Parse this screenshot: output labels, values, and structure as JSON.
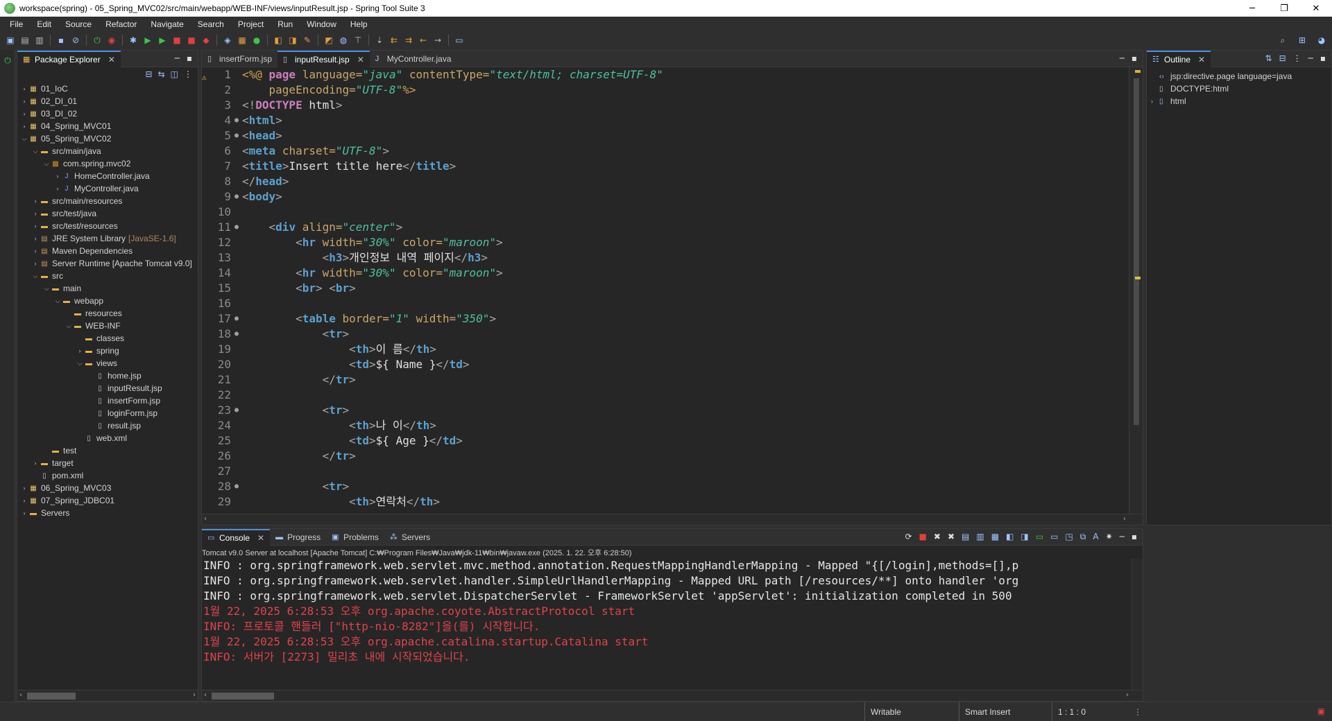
{
  "window": {
    "title": "workspace(spring) - 05_Spring_MVC02/src/main/webapp/WEB-INF/views/inputResult.jsp - Spring Tool Suite 3"
  },
  "menu": [
    "File",
    "Edit",
    "Source",
    "Refactor",
    "Navigate",
    "Search",
    "Project",
    "Run",
    "Window",
    "Help"
  ],
  "package_explorer": {
    "tab_label": "Package Explorer",
    "tree": [
      {
        "label": "01_IoC",
        "icon": "project",
        "arrow": "›",
        "indent": 0
      },
      {
        "label": "02_DI_01",
        "icon": "project",
        "arrow": "›",
        "indent": 0
      },
      {
        "label": "03_DI_02",
        "icon": "project",
        "arrow": "›",
        "indent": 0
      },
      {
        "label": "04_Spring_MVC01",
        "icon": "project",
        "arrow": "›",
        "indent": 0
      },
      {
        "label": "05_Spring_MVC02",
        "icon": "project",
        "arrow": "⌄",
        "indent": 0
      },
      {
        "label": "src/main/java",
        "icon": "folder",
        "arrow": "⌄",
        "indent": 1
      },
      {
        "label": "com.spring.mvc02",
        "icon": "package",
        "arrow": "⌄",
        "indent": 2
      },
      {
        "label": "HomeController.java",
        "icon": "java",
        "arrow": "›",
        "indent": 3
      },
      {
        "label": "MyController.java",
        "icon": "java",
        "arrow": "›",
        "indent": 3
      },
      {
        "label": "src/main/resources",
        "icon": "folder",
        "arrow": "›",
        "indent": 1
      },
      {
        "label": "src/test/java",
        "icon": "folder",
        "arrow": "›",
        "indent": 1
      },
      {
        "label": "src/test/resources",
        "icon": "folder",
        "arrow": "›",
        "indent": 1
      },
      {
        "label": "JRE System Library",
        "decor": "[JavaSE-1.6]",
        "icon": "library",
        "arrow": "›",
        "indent": 1
      },
      {
        "label": "Maven Dependencies",
        "icon": "library",
        "arrow": "›",
        "indent": 1
      },
      {
        "label": "Server Runtime [Apache Tomcat v9.0]",
        "icon": "library",
        "arrow": "›",
        "indent": 1
      },
      {
        "label": "src",
        "icon": "folder",
        "arrow": "⌄",
        "indent": 1
      },
      {
        "label": "main",
        "icon": "folder",
        "arrow": "⌄",
        "indent": 2
      },
      {
        "label": "webapp",
        "icon": "folder",
        "arrow": "⌄",
        "indent": 3
      },
      {
        "label": "resources",
        "icon": "folder",
        "arrow": "",
        "indent": 4
      },
      {
        "label": "WEB-INF",
        "icon": "folder",
        "arrow": "⌄",
        "indent": 4
      },
      {
        "label": "classes",
        "icon": "folder",
        "arrow": "",
        "indent": 5
      },
      {
        "label": "spring",
        "icon": "folder",
        "arrow": "›",
        "indent": 5
      },
      {
        "label": "views",
        "icon": "folder",
        "arrow": "⌄",
        "indent": 5
      },
      {
        "label": "home.jsp",
        "icon": "file",
        "arrow": "",
        "indent": 6
      },
      {
        "label": "inputResult.jsp",
        "icon": "file",
        "arrow": "",
        "indent": 6
      },
      {
        "label": "insertForm.jsp",
        "icon": "file",
        "arrow": "",
        "indent": 6
      },
      {
        "label": "loginForm.jsp",
        "icon": "file",
        "arrow": "",
        "indent": 6
      },
      {
        "label": "result.jsp",
        "icon": "file",
        "arrow": "",
        "indent": 6
      },
      {
        "label": "web.xml",
        "icon": "file",
        "arrow": "",
        "indent": 5
      },
      {
        "label": "test",
        "icon": "folder",
        "arrow": "",
        "indent": 2
      },
      {
        "label": "target",
        "icon": "folder",
        "arrow": "›",
        "indent": 1
      },
      {
        "label": "pom.xml",
        "icon": "file",
        "arrow": "",
        "indent": 1
      },
      {
        "label": "06_Spring_MVC03",
        "icon": "project",
        "arrow": "›",
        "indent": 0
      },
      {
        "label": "07_Spring_JDBC01",
        "icon": "project",
        "arrow": "›",
        "indent": 0
      },
      {
        "label": "Servers",
        "icon": "folder",
        "arrow": "›",
        "indent": 0
      }
    ]
  },
  "editor": {
    "tabs": [
      {
        "label": "insertForm.jsp",
        "active": false
      },
      {
        "label": "inputResult.jsp",
        "active": true
      },
      {
        "label": "MyController.java",
        "active": false
      }
    ],
    "lines": [
      {
        "n": "1",
        "fold": "",
        "parts": [
          [
            "jsp",
            "<%@ "
          ],
          [
            "kw",
            "page "
          ],
          [
            "attr",
            "language="
          ],
          [
            "val",
            "\"java\" "
          ],
          [
            "attr",
            "contentType="
          ],
          [
            "val",
            "\"text/html; charset=UTF-8\""
          ]
        ]
      },
      {
        "n": "2",
        "fold": "",
        "parts": [
          [
            "txt",
            "    "
          ],
          [
            "attr",
            "pageEncoding="
          ],
          [
            "val",
            "\"UTF-8\""
          ],
          [
            "jsp",
            "%>"
          ]
        ]
      },
      {
        "n": "3",
        "fold": "",
        "parts": [
          [
            "br",
            "<!"
          ],
          [
            "kw",
            "DOCTYPE "
          ],
          [
            "txt",
            "html"
          ],
          [
            "br",
            ">"
          ]
        ]
      },
      {
        "n": "4",
        "fold": "●",
        "parts": [
          [
            "br",
            "<"
          ],
          [
            "tag",
            "html"
          ],
          [
            "br",
            ">"
          ]
        ]
      },
      {
        "n": "5",
        "fold": "●",
        "parts": [
          [
            "br",
            "<"
          ],
          [
            "tag",
            "head"
          ],
          [
            "br",
            ">"
          ]
        ]
      },
      {
        "n": "6",
        "fold": "",
        "parts": [
          [
            "br",
            "<"
          ],
          [
            "tag",
            "meta "
          ],
          [
            "attr",
            "charset="
          ],
          [
            "val",
            "\"UTF-8\""
          ],
          [
            "br",
            ">"
          ]
        ]
      },
      {
        "n": "7",
        "fold": "",
        "parts": [
          [
            "br",
            "<"
          ],
          [
            "tag",
            "title"
          ],
          [
            "br",
            ">"
          ],
          [
            "txt",
            "Insert title here"
          ],
          [
            "br",
            "</"
          ],
          [
            "tag",
            "title"
          ],
          [
            "br",
            ">"
          ]
        ]
      },
      {
        "n": "8",
        "fold": "",
        "parts": [
          [
            "br",
            "</"
          ],
          [
            "tag",
            "head"
          ],
          [
            "br",
            ">"
          ]
        ]
      },
      {
        "n": "9",
        "fold": "●",
        "parts": [
          [
            "br",
            "<"
          ],
          [
            "tag",
            "body"
          ],
          [
            "br",
            ">"
          ]
        ]
      },
      {
        "n": "10",
        "fold": "",
        "parts": []
      },
      {
        "n": "11",
        "fold": "●",
        "parts": [
          [
            "txt",
            "    "
          ],
          [
            "br",
            "<"
          ],
          [
            "tag",
            "div "
          ],
          [
            "attr",
            "align="
          ],
          [
            "val",
            "\"center\""
          ],
          [
            "br",
            ">"
          ]
        ]
      },
      {
        "n": "12",
        "fold": "",
        "parts": [
          [
            "txt",
            "        "
          ],
          [
            "br",
            "<"
          ],
          [
            "tag",
            "hr "
          ],
          [
            "attr",
            "width="
          ],
          [
            "val",
            "\"30%\" "
          ],
          [
            "attr",
            "color="
          ],
          [
            "val",
            "\"maroon\""
          ],
          [
            "br",
            ">"
          ]
        ]
      },
      {
        "n": "13",
        "fold": "",
        "parts": [
          [
            "txt",
            "            "
          ],
          [
            "br",
            "<"
          ],
          [
            "tag",
            "h3"
          ],
          [
            "br",
            ">"
          ],
          [
            "txt",
            "개인정보 내역 페이지"
          ],
          [
            "br",
            "</"
          ],
          [
            "tag",
            "h3"
          ],
          [
            "br",
            ">"
          ]
        ]
      },
      {
        "n": "14",
        "fold": "",
        "parts": [
          [
            "txt",
            "        "
          ],
          [
            "br",
            "<"
          ],
          [
            "tag",
            "hr "
          ],
          [
            "attr",
            "width="
          ],
          [
            "val",
            "\"30%\" "
          ],
          [
            "attr",
            "color="
          ],
          [
            "val",
            "\"maroon\""
          ],
          [
            "br",
            ">"
          ]
        ]
      },
      {
        "n": "15",
        "fold": "",
        "parts": [
          [
            "txt",
            "        "
          ],
          [
            "br",
            "<"
          ],
          [
            "tag",
            "br"
          ],
          [
            "br",
            "> <"
          ],
          [
            "tag",
            "br"
          ],
          [
            "br",
            ">"
          ]
        ]
      },
      {
        "n": "16",
        "fold": "",
        "parts": []
      },
      {
        "n": "17",
        "fold": "●",
        "warn": true,
        "parts": [
          [
            "txt",
            "        "
          ],
          [
            "br",
            "<"
          ],
          [
            "tag",
            "table "
          ],
          [
            "attr",
            "border="
          ],
          [
            "val",
            "\"1\" "
          ],
          [
            "attr",
            "width="
          ],
          [
            "val",
            "\"350\""
          ],
          [
            "br",
            ">"
          ]
        ]
      },
      {
        "n": "18",
        "fold": "●",
        "parts": [
          [
            "txt",
            "            "
          ],
          [
            "br",
            "<"
          ],
          [
            "tag",
            "tr"
          ],
          [
            "br",
            ">"
          ]
        ]
      },
      {
        "n": "19",
        "fold": "",
        "parts": [
          [
            "txt",
            "                "
          ],
          [
            "br",
            "<"
          ],
          [
            "tag",
            "th"
          ],
          [
            "br",
            ">"
          ],
          [
            "txt",
            "이 름"
          ],
          [
            "br",
            "</"
          ],
          [
            "tag",
            "th"
          ],
          [
            "br",
            ">"
          ]
        ]
      },
      {
        "n": "20",
        "fold": "",
        "parts": [
          [
            "txt",
            "                "
          ],
          [
            "br",
            "<"
          ],
          [
            "tag",
            "td"
          ],
          [
            "br",
            ">"
          ],
          [
            "txt",
            "${ Name }"
          ],
          [
            "br",
            "</"
          ],
          [
            "tag",
            "td"
          ],
          [
            "br",
            ">"
          ]
        ]
      },
      {
        "n": "21",
        "fold": "",
        "parts": [
          [
            "txt",
            "            "
          ],
          [
            "br",
            "</"
          ],
          [
            "tag",
            "tr"
          ],
          [
            "br",
            ">"
          ]
        ]
      },
      {
        "n": "22",
        "fold": "",
        "parts": []
      },
      {
        "n": "23",
        "fold": "●",
        "parts": [
          [
            "txt",
            "            "
          ],
          [
            "br",
            "<"
          ],
          [
            "tag",
            "tr"
          ],
          [
            "br",
            ">"
          ]
        ]
      },
      {
        "n": "24",
        "fold": "",
        "parts": [
          [
            "txt",
            "                "
          ],
          [
            "br",
            "<"
          ],
          [
            "tag",
            "th"
          ],
          [
            "br",
            ">"
          ],
          [
            "txt",
            "나 이"
          ],
          [
            "br",
            "</"
          ],
          [
            "tag",
            "th"
          ],
          [
            "br",
            ">"
          ]
        ]
      },
      {
        "n": "25",
        "fold": "",
        "parts": [
          [
            "txt",
            "                "
          ],
          [
            "br",
            "<"
          ],
          [
            "tag",
            "td"
          ],
          [
            "br",
            ">"
          ],
          [
            "txt",
            "${ Age }"
          ],
          [
            "br",
            "</"
          ],
          [
            "tag",
            "td"
          ],
          [
            "br",
            ">"
          ]
        ]
      },
      {
        "n": "26",
        "fold": "",
        "parts": [
          [
            "txt",
            "            "
          ],
          [
            "br",
            "</"
          ],
          [
            "tag",
            "tr"
          ],
          [
            "br",
            ">"
          ]
        ]
      },
      {
        "n": "27",
        "fold": "",
        "parts": []
      },
      {
        "n": "28",
        "fold": "●",
        "parts": [
          [
            "txt",
            "            "
          ],
          [
            "br",
            "<"
          ],
          [
            "tag",
            "tr"
          ],
          [
            "br",
            ">"
          ]
        ]
      },
      {
        "n": "29",
        "fold": "",
        "parts": [
          [
            "txt",
            "                "
          ],
          [
            "br",
            "<"
          ],
          [
            "tag",
            "th"
          ],
          [
            "br",
            ">"
          ],
          [
            "txt",
            "연락처"
          ],
          [
            "br",
            "</"
          ],
          [
            "tag",
            "th"
          ],
          [
            "br",
            ">"
          ]
        ]
      }
    ]
  },
  "outline": {
    "tab_label": "Outline",
    "items": [
      {
        "label": "jsp:directive.page language=java",
        "icon": "directive",
        "arrow": ""
      },
      {
        "label": "DOCTYPE:html",
        "icon": "doctype",
        "arrow": ""
      },
      {
        "label": "html",
        "icon": "element",
        "arrow": "›"
      }
    ]
  },
  "console": {
    "tabs": [
      {
        "label": "Console",
        "active": true
      },
      {
        "label": "Progress",
        "active": false
      },
      {
        "label": "Problems",
        "active": false
      },
      {
        "label": "Servers",
        "active": false
      }
    ],
    "header": "Tomcat v9.0 Server at localhost [Apache Tomcat] C:₩Program Files₩Java₩jdk-11₩bin₩javaw.exe  (2025. 1. 22. 오후 6:28:50)",
    "lines": [
      {
        "type": "info",
        "text": "INFO : org.springframework.web.servlet.mvc.method.annotation.RequestMappingHandlerMapping - Mapped \"{[/login],methods=[],p"
      },
      {
        "type": "info",
        "text": "INFO : org.springframework.web.servlet.handler.SimpleUrlHandlerMapping - Mapped URL path [/resources/**] onto handler 'org"
      },
      {
        "type": "info",
        "text": "INFO : org.springframework.web.servlet.DispatcherServlet - FrameworkServlet 'appServlet': initialization completed in 500"
      },
      {
        "type": "err",
        "text": "1월 22, 2025 6:28:53 오후 org.apache.coyote.AbstractProtocol start"
      },
      {
        "type": "err",
        "text": "INFO: 프로토콜 핸들러 [\"http-nio-8282\"]을(를) 시작합니다."
      },
      {
        "type": "err",
        "text": "1월 22, 2025 6:28:53 오후 org.apache.catalina.startup.Catalina start"
      },
      {
        "type": "err",
        "text": "INFO: 서버가 [2273] 밀리초 내에 시작되었습니다."
      }
    ]
  },
  "status": {
    "writable": "Writable",
    "insert_mode": "Smart Insert",
    "position": "1 : 1 : 0"
  },
  "colors": {
    "accent": "#4a90d9",
    "error_text": "#e0434b",
    "tag": "#5ba1cf",
    "attr_value": "#4fbfa0"
  }
}
